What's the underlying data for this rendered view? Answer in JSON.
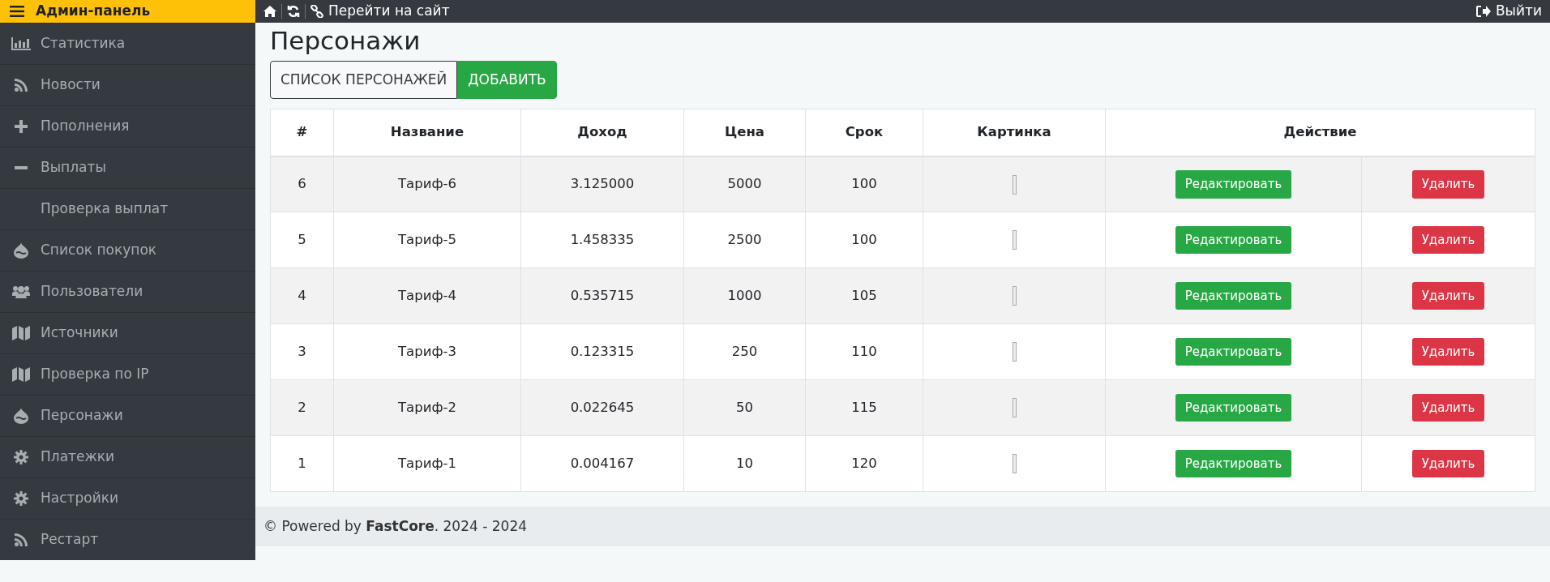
{
  "brand": {
    "title": "Админ-панель"
  },
  "topbar": {
    "links": [
      {
        "label": "Перейти на сайт"
      }
    ],
    "logout": "Выйти"
  },
  "sidebar": {
    "items": [
      {
        "label": "Статистика"
      },
      {
        "label": "Новости"
      },
      {
        "label": "Пополнения"
      },
      {
        "label": "Выплаты"
      },
      {
        "label": "Проверка выплат"
      },
      {
        "label": "Список покупок"
      },
      {
        "label": "Пользователи"
      },
      {
        "label": "Источники"
      },
      {
        "label": "Проверка по IP"
      },
      {
        "label": "Персонажи"
      },
      {
        "label": "Платежки"
      },
      {
        "label": "Настройки"
      },
      {
        "label": "Рестарт"
      }
    ]
  },
  "page": {
    "title": "Персонажи"
  },
  "tabs": [
    {
      "label": "СПИСОК ПЕРСОНАЖЕЙ",
      "selected": false
    },
    {
      "label": "ДОБАВИТЬ",
      "selected": true
    }
  ],
  "table": {
    "columns": [
      "#",
      "Название",
      "Доход",
      "Цена",
      "Срок",
      "Картинка",
      "Действие"
    ],
    "rows": [
      {
        "id": "6",
        "name": "Тариф-6",
        "income": "3.125000",
        "price": "5000",
        "term": "100",
        "edit": "Редактировать",
        "delete": "Удалить"
      },
      {
        "id": "5",
        "name": "Тариф-5",
        "income": "1.458335",
        "price": "2500",
        "term": "100",
        "edit": "Редактировать",
        "delete": "Удалить"
      },
      {
        "id": "4",
        "name": "Тариф-4",
        "income": "0.535715",
        "price": "1000",
        "term": "105",
        "edit": "Редактировать",
        "delete": "Удалить"
      },
      {
        "id": "3",
        "name": "Тариф-3",
        "income": "0.123315",
        "price": "250",
        "term": "110",
        "edit": "Редактировать",
        "delete": "Удалить"
      },
      {
        "id": "2",
        "name": "Тариф-2",
        "income": "0.022645",
        "price": "50",
        "term": "115",
        "edit": "Редактировать",
        "delete": "Удалить"
      },
      {
        "id": "1",
        "name": "Тариф-1",
        "income": "0.004167",
        "price": "10",
        "term": "120",
        "edit": "Редактировать",
        "delete": "Удалить"
      }
    ]
  },
  "footer": {
    "text": "© Powered by **FastCore**. 2024 - 2024"
  }
}
